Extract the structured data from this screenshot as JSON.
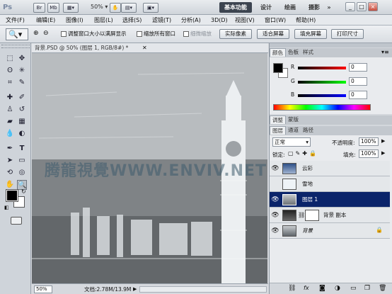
{
  "app": {
    "logo": "Ps",
    "title_icons": [
      "Br",
      "Mb"
    ],
    "zoom": "50%",
    "workspaces": [
      "基本功能",
      "设计",
      "绘画",
      "摄影"
    ],
    "workspace_more": "»",
    "window_buttons": [
      "_",
      "□",
      "×"
    ]
  },
  "menu": [
    "文件(F)",
    "编辑(E)",
    "图像(I)",
    "图层(L)",
    "选择(S)",
    "滤镜(T)",
    "分析(A)",
    "3D(D)",
    "视图(V)",
    "窗口(W)",
    "帮助(H)"
  ],
  "options": {
    "resize_windows": "调整窗口大小以满屏显示",
    "zoom_all": "缩放所有窗口",
    "scrubby": "细微缩放",
    "buttons": [
      "实际像素",
      "适合屏幕",
      "填充屏幕",
      "打印尺寸"
    ]
  },
  "document": {
    "tab_title": "背景.PSD @ 50% (图层 1, RGB/8#) *",
    "watermark": "腾龍視覺WWW.ENVIV.NET",
    "status_zoom": "50%",
    "status_doc": "文档:2.78M/13.9M"
  },
  "color_panel": {
    "tabs": [
      "颜色",
      "色板",
      "样式"
    ],
    "channels": [
      {
        "label": "R",
        "value": "0",
        "color": "#cc0000"
      },
      {
        "label": "G",
        "value": "0",
        "color": "#00a000"
      },
      {
        "label": "B",
        "value": "0",
        "color": "#0000cc"
      }
    ]
  },
  "adjust_panel": {
    "tabs": [
      "调整",
      "蒙版"
    ]
  },
  "layers_panel": {
    "tabs": [
      "图层",
      "通道",
      "路径"
    ],
    "blend_mode": "正常",
    "opacity_label": "不透明度:",
    "opacity_value": "100%",
    "lock_label": "锁定:",
    "fill_label": "填充:",
    "fill_value": "100%",
    "layers": [
      {
        "name": "云彩",
        "visible": true,
        "selected": false,
        "thumb_color": "#5a6f9e"
      },
      {
        "name": "雪地",
        "visible": false,
        "selected": false,
        "thumb_color": "#eef3f7"
      },
      {
        "name": "图层 1",
        "visible": true,
        "selected": true,
        "thumb_color": "#9aa0a6"
      },
      {
        "name": "背景 副本",
        "visible": true,
        "selected": false,
        "thumb_color": "#444"
      },
      {
        "name": "背景",
        "visible": true,
        "selected": false,
        "thumb_color": "#8d939a",
        "locked": true
      }
    ]
  }
}
